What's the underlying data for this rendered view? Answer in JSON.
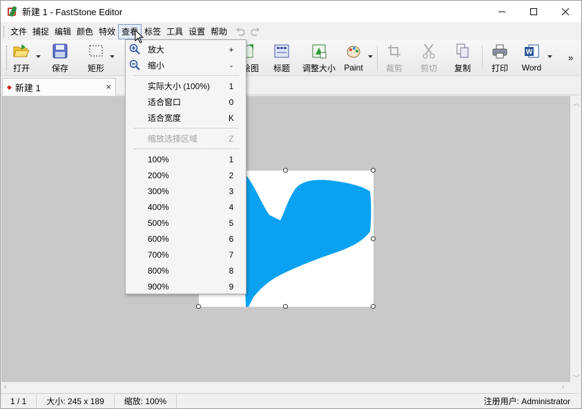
{
  "window": {
    "title": "新建 1 - FastStone Editor"
  },
  "menubar": {
    "items": [
      "文件",
      "捕捉",
      "编辑",
      "颜色",
      "特效",
      "查看",
      "标签",
      "工具",
      "设置",
      "帮助"
    ],
    "active_index": 5
  },
  "toolbar": {
    "open": "打开",
    "save": "保存",
    "rect": "矩形",
    "draw": "绘图",
    "caption": "标题",
    "resize": "调整大小",
    "paint": "Paint",
    "crop": "裁剪",
    "cut": "剪切",
    "copy": "复制",
    "print": "打印",
    "word": "Word",
    "more": "»"
  },
  "tab": {
    "name": "新建 1",
    "close": "×"
  },
  "view_menu": {
    "items": [
      {
        "label": "放大",
        "key": "+",
        "icon": "zoom-in-icon",
        "enabled": true
      },
      {
        "label": "缩小",
        "key": "-",
        "icon": "zoom-out-icon",
        "enabled": true
      },
      {
        "label": "实际大小 (100%)",
        "key": "1",
        "enabled": true
      },
      {
        "label": "适合窗口",
        "key": "0",
        "enabled": true
      },
      {
        "label": "适合宽度",
        "key": "K",
        "enabled": true
      },
      {
        "label": "缩放选择区域",
        "key": "Z",
        "enabled": false
      },
      {
        "label": "100%",
        "key": "1",
        "enabled": true
      },
      {
        "label": "200%",
        "key": "2",
        "enabled": true
      },
      {
        "label": "300%",
        "key": "3",
        "enabled": true
      },
      {
        "label": "400%",
        "key": "4",
        "enabled": true
      },
      {
        "label": "500%",
        "key": "5",
        "enabled": true
      },
      {
        "label": "600%",
        "key": "6",
        "enabled": true
      },
      {
        "label": "700%",
        "key": "7",
        "enabled": true
      },
      {
        "label": "800%",
        "key": "8",
        "enabled": true
      },
      {
        "label": "900%",
        "key": "9",
        "enabled": true
      }
    ]
  },
  "statusbar": {
    "page": "1 / 1",
    "size": "大小:  245 x 189",
    "zoom": "缩放:  100%",
    "user": "注册用户: Administrator"
  },
  "colors": {
    "heart": "#0aa2f0",
    "canvas_bg": "#c8c8c8"
  }
}
